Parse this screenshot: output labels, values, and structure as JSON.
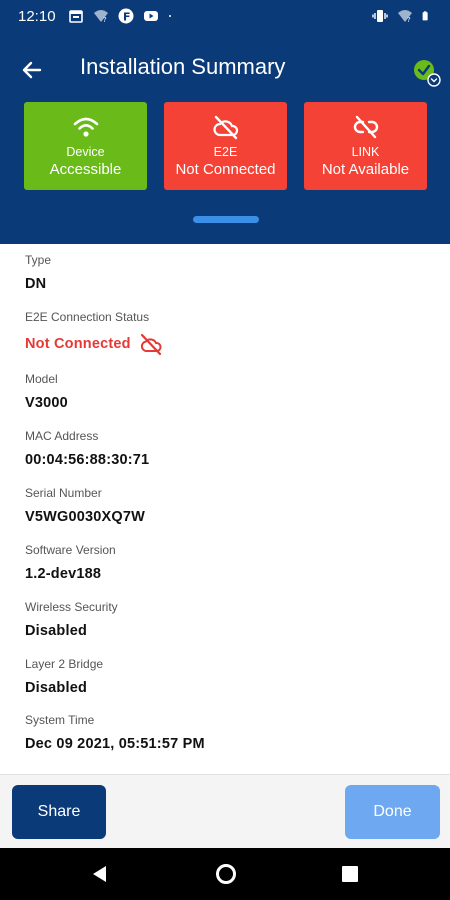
{
  "status_bar": {
    "time": "12:10",
    "left_icons": [
      "calendar-icon",
      "wifi-question-icon",
      "app-f-icon",
      "youtube-icon",
      "dot-icon"
    ],
    "right_icons": [
      "vibrate-icon",
      "wifi-icon",
      "battery-icon"
    ]
  },
  "header": {
    "title": "Installation Summary",
    "status_icon": "check-circle-icon",
    "cards": [
      {
        "line1": "Device",
        "line2": "Accessible",
        "icon": "wifi-icon",
        "color": "#6aba1a"
      },
      {
        "line1": "E2E",
        "line2": "Not Connected",
        "icon": "cloud-off-icon",
        "color": "#f44336"
      },
      {
        "line1": "LINK",
        "line2": "Not Available",
        "icon": "link-off-icon",
        "color": "#f44336"
      }
    ]
  },
  "details": [
    {
      "label": "Type",
      "value": "DN"
    },
    {
      "label": "E2E Connection Status",
      "value": "Not Connected",
      "status": "error"
    },
    {
      "label": "Model",
      "value": "V3000"
    },
    {
      "label": "MAC Address",
      "value": "00:04:56:88:30:71"
    },
    {
      "label": "Serial Number",
      "value": "V5WG0030XQ7W"
    },
    {
      "label": "Software Version",
      "value": "1.2-dev188"
    },
    {
      "label": "Wireless Security",
      "value": "Disabled"
    },
    {
      "label": "Layer 2 Bridge",
      "value": "Disabled"
    },
    {
      "label": "System Time",
      "value": "Dec 09 2021, 05:51:57 PM"
    }
  ],
  "buttons": {
    "share": "Share",
    "done": "Done"
  },
  "colors": {
    "header_bg": "#0b3a78",
    "success": "#6aba1a",
    "error": "#f44336",
    "done_disabled": "#6ea8f0"
  }
}
